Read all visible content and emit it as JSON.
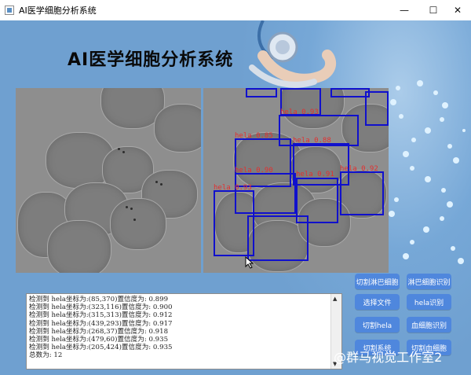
{
  "window": {
    "title": "AI医学细胞分析系统",
    "minimize": "—",
    "maximize": "☐",
    "close": "✕"
  },
  "app_title": "AI医学细胞分析系统",
  "detections": [
    {
      "label": "hela 0.85"
    },
    {
      "label": "hela 0.90"
    },
    {
      "label": "hela 0.91"
    },
    {
      "label": "hela 0.92"
    },
    {
      "label": "hela 0.93"
    },
    {
      "label": "hela 0.88"
    },
    {
      "label": "hela 0.93"
    }
  ],
  "log": {
    "lines": [
      "检测到 hela坐标为:(85,370)置信度为: 0.899",
      "检测到 hela坐标为:(323,116)置信度为: 0.900",
      "检测到 hela坐标为:(315,313)置信度为: 0.912",
      "检测到 hela坐标为:(439,293)置信度为: 0.917",
      "检测到 hela坐标为:(268,37)置信度为: 0.918",
      "检测到 hela坐标为:(479,60)置信度为: 0.935",
      "检测到 hela坐标为:(205,424)置信度为: 0.935",
      "总数为: 12"
    ]
  },
  "buttons": {
    "cut_lymph": "切割淋巴细胞",
    "lymph_detect": "淋巴细胞识别",
    "select_file": "选择文件",
    "hela_detect": "hela识别",
    "cut_hela": "切割hela",
    "blood_detect": "血细胞识别",
    "cut_blood": "切割血细胞",
    "cut_system": "切割系统"
  },
  "watermark": "知乎 @群马视觉工作室2",
  "colors": {
    "background": "#6fa0d0",
    "button": "#4f87dd",
    "box": "#1010cc",
    "label": "#e23030"
  }
}
